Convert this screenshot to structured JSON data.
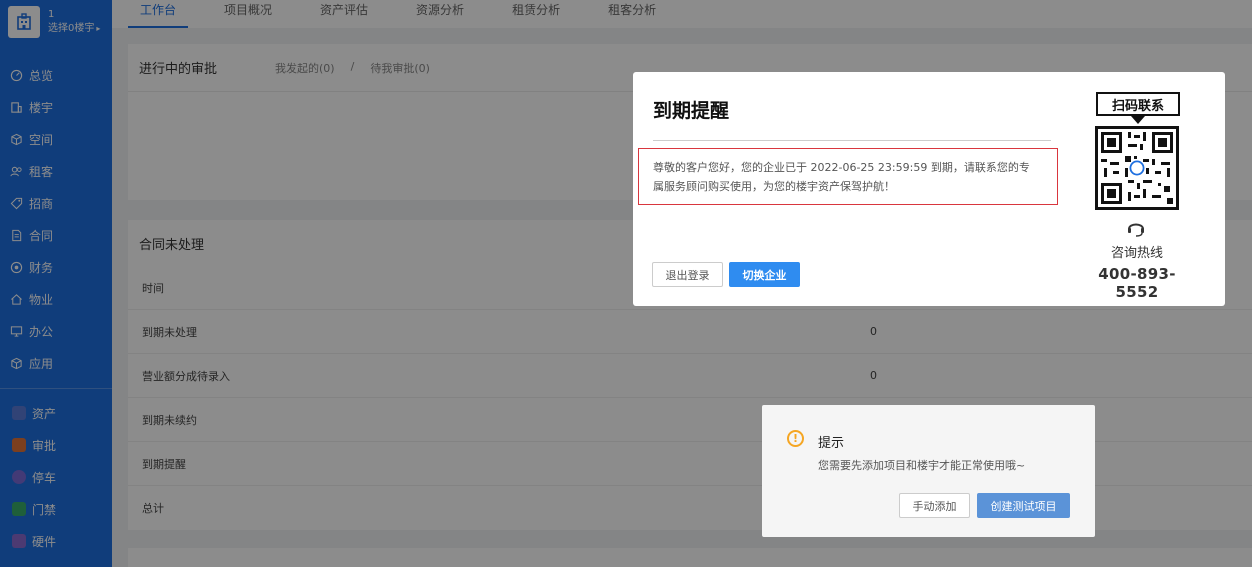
{
  "sidebar": {
    "project_num": "1",
    "building_select": "选择0楼宇",
    "menu": [
      "总览",
      "楼宇",
      "空间",
      "租客",
      "招商",
      "合同",
      "财务",
      "物业",
      "办公",
      "应用"
    ],
    "modules": [
      {
        "label": "资产",
        "color": "#5a7bd8"
      },
      {
        "label": "审批",
        "color": "#e0733a"
      },
      {
        "label": "停车",
        "color": "#7a6bd8"
      },
      {
        "label": "门禁",
        "color": "#3aae6a"
      },
      {
        "label": "硬件",
        "color": "#8a6bd0"
      }
    ]
  },
  "tabs": [
    "工作台",
    "项目概况",
    "资产评估",
    "资源分析",
    "租赁分析",
    "租客分析"
  ],
  "pending_approval": {
    "title": "进行中的审批",
    "initiated": "我发起的(0)",
    "separator": "/",
    "to_approve": "待我审批(0)"
  },
  "contracts": {
    "title": "合同未处理",
    "rows": [
      {
        "label": "时间",
        "value": ""
      },
      {
        "label": "到期未处理",
        "value": "0"
      },
      {
        "label": "营业额分成待录入",
        "value": "0"
      },
      {
        "label": "到期未续约",
        "value": ""
      },
      {
        "label": "到期提醒",
        "value": ""
      },
      {
        "label": "总计",
        "value": ""
      }
    ]
  },
  "expiry_modal": {
    "title": "到期提醒",
    "message_line1": "尊敬的客户您好，您的企业已于 2022-06-25 23:59:59 到期，请联系您的专",
    "message_line2": "属服务顾问购买使用，为您的楼宇资产保驾护航！",
    "logout_label": "退出登录",
    "switch_label": "切换企业",
    "qr_label": "扫码联系",
    "hotline_label": "咨询热线",
    "hotline_number": "400-893-5552"
  },
  "tip_dialog": {
    "title": "提示",
    "message": "您需要先添加项目和楼宇才能正常使用哦~",
    "manual_label": "手动添加",
    "create_label": "创建测试项目"
  }
}
